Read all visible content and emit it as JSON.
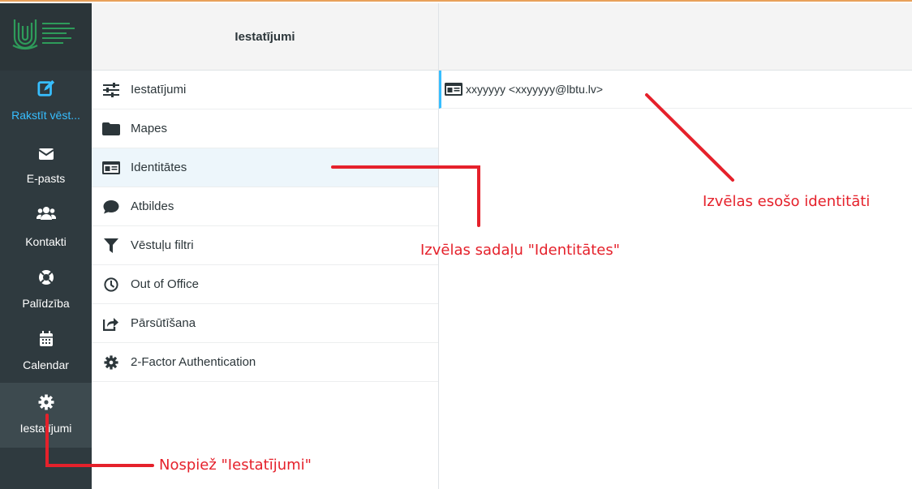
{
  "colors": {
    "nav_bg": "#2f3a3f",
    "accent": "#37beff",
    "annotation": "#e5212b",
    "top_border": "#e8a15a",
    "selected_row": "#edf6fb"
  },
  "nav": {
    "items": [
      {
        "label": "Rakstīt vēst...",
        "icon": "compose-icon"
      },
      {
        "label": "E-pasts",
        "icon": "envelope-icon"
      },
      {
        "label": "Kontakti",
        "icon": "users-icon"
      },
      {
        "label": "Palīdzība",
        "icon": "lifebuoy-icon"
      },
      {
        "label": "Calendar",
        "icon": "calendar-icon"
      },
      {
        "label": "Iestatījumi",
        "icon": "gear-icon"
      }
    ]
  },
  "settings": {
    "header": "Iestatījumi",
    "items": [
      {
        "label": "Iestatījumi",
        "icon": "sliders-icon"
      },
      {
        "label": "Mapes",
        "icon": "folder-icon"
      },
      {
        "label": "Identitātes",
        "icon": "id-card-icon"
      },
      {
        "label": "Atbildes",
        "icon": "comment-icon"
      },
      {
        "label": "Vēstuļu filtri",
        "icon": "filter-icon"
      },
      {
        "label": "Out of Office",
        "icon": "clock-icon"
      },
      {
        "label": "Pārsūtīšana",
        "icon": "forward-icon"
      },
      {
        "label": "2-Factor Authentication",
        "icon": "gear-icon"
      }
    ]
  },
  "identities": {
    "items": [
      {
        "label": "xxyyyyy <xxyyyyy@lbtu.lv>",
        "icon": "id-card-icon"
      }
    ]
  },
  "annotations": {
    "choose_section": "Izvēlas sadaļu \"Identitātes\"",
    "choose_identity": "Izvēlas esošo identitāti",
    "press_settings": "Nospiež \"Iestatījumi\""
  }
}
